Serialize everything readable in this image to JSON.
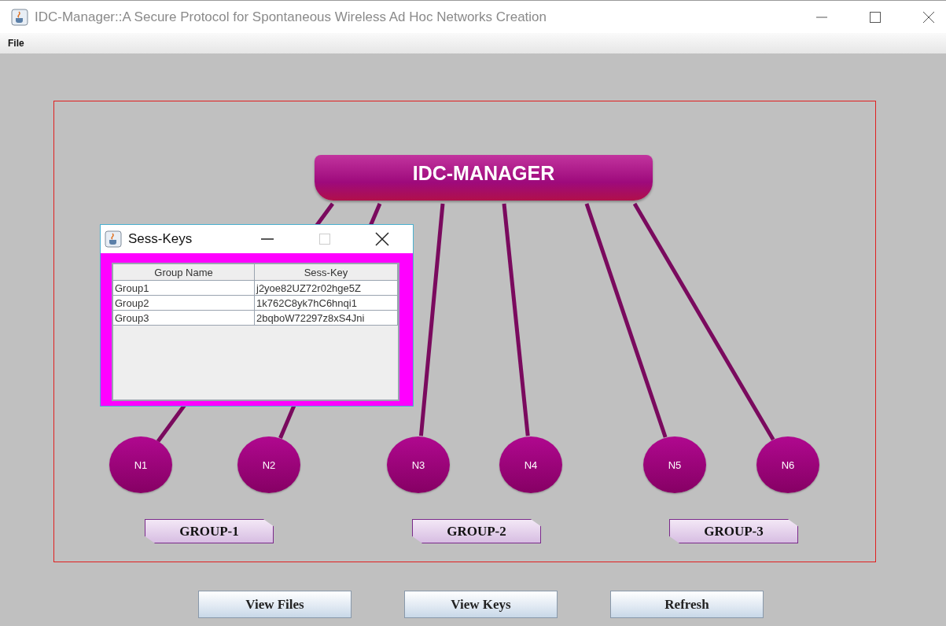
{
  "window": {
    "title": "IDC-Manager::A Secure Protocol for Spontaneous Wireless Ad Hoc Networks Creation"
  },
  "menu": [
    "File"
  ],
  "manager": {
    "label": "IDC-MANAGER"
  },
  "nodes": [
    {
      "label": "N1"
    },
    {
      "label": "N2"
    },
    {
      "label": "N3"
    },
    {
      "label": "N4"
    },
    {
      "label": "N5"
    },
    {
      "label": "N6"
    }
  ],
  "groups": [
    {
      "label": "GROUP-1"
    },
    {
      "label": "GROUP-2"
    },
    {
      "label": "GROUP-3"
    }
  ],
  "dialog": {
    "title": "Sess-Keys",
    "columns": [
      "Group Name",
      "Sess-Key"
    ],
    "rows": [
      [
        "Group1",
        "j2yoe82UZ72r02hge5Z"
      ],
      [
        "Group2",
        "1k762C8yk7hC6hnqi1"
      ],
      [
        "Group3",
        "2bqboW72297z8xS4Jni"
      ]
    ]
  },
  "buttons": [
    "View Files",
    "View Keys",
    "Refresh"
  ]
}
